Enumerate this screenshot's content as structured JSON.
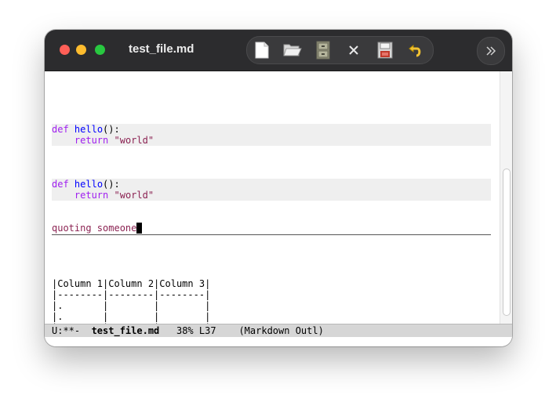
{
  "window": {
    "title": "test_file.md"
  },
  "toolbar": {
    "buttons": [
      {
        "name": "new-file",
        "icon": "new-file-icon"
      },
      {
        "name": "open-folder",
        "icon": "folder-open-icon"
      },
      {
        "name": "file-cabinet",
        "icon": "file-cabinet-icon"
      },
      {
        "name": "close-buffer",
        "icon": "close-x-icon"
      },
      {
        "name": "save",
        "icon": "floppy-disk-icon"
      },
      {
        "name": "undo",
        "icon": "undo-arrow-icon"
      }
    ],
    "overflow_icon": "double-chevron-right-icon"
  },
  "editor": {
    "code_block_1": {
      "keyword": "def",
      "func": "hello",
      "paren": "():",
      "ret_kw": "return",
      "ret_val": "\"world\""
    },
    "code_block_2": {
      "keyword": "def",
      "func": "hello",
      "paren": "():",
      "ret_kw": "return",
      "ret_val": "\"world\""
    },
    "quote_text": "quoting someone",
    "table_lines": [
      "|Column 1|Column 2|Column 3|",
      "|--------|--------|--------|",
      "|.       |        |        |",
      "|.       |        |        |",
      "|.       |        |        |"
    ]
  },
  "modeline": {
    "state": "U:**-",
    "buffer": "test_file.md",
    "position": "38% L37",
    "mode": "(Markdown Outl)"
  },
  "colors": {
    "titlebar": "#2c2c2e",
    "keyword": "#a020f0",
    "function": "#0000ff",
    "string": "#8b2252"
  }
}
